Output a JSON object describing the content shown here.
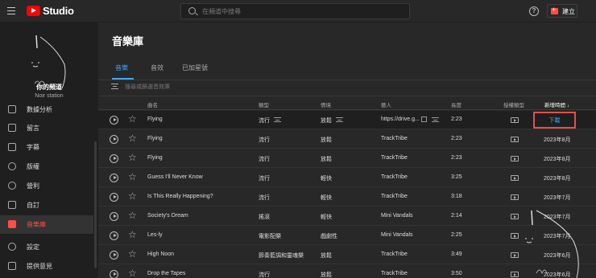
{
  "header": {
    "logo_text": "Studio",
    "search_placeholder": "在頻道中搜尋",
    "help_icon": "?",
    "create_label": "建立"
  },
  "sidebar": {
    "channel_name": "你的頻道",
    "channel_subtitle": "Noir station",
    "items": [
      {
        "label": "數據分析",
        "icon": "analytics-icon"
      },
      {
        "label": "留言",
        "icon": "comments-icon"
      },
      {
        "label": "字幕",
        "icon": "subtitles-icon"
      },
      {
        "label": "版權",
        "icon": "copyright-icon"
      },
      {
        "label": "營利",
        "icon": "monetization-icon"
      },
      {
        "label": "自訂",
        "icon": "customization-icon"
      },
      {
        "label": "音樂庫",
        "icon": "audio-library-icon"
      },
      {
        "label": "設定",
        "icon": "settings-icon"
      },
      {
        "label": "提供意見",
        "icon": "feedback-icon"
      }
    ],
    "active_index": 6
  },
  "main": {
    "title": "音樂庫",
    "tabs": [
      {
        "label": "音樂"
      },
      {
        "label": "音效"
      },
      {
        "label": "已加星號"
      }
    ],
    "filter_placeholder": "搜尋或篩選音效庫",
    "columns": {
      "title": "曲名",
      "genre": "類型",
      "mood": "情境",
      "artist": "藝人",
      "duration": "長度",
      "license": "授權類型",
      "added": "新增時間 ↓"
    },
    "rows": [
      {
        "title": "Flying",
        "genre": "流行",
        "mood": "放鬆",
        "artist": "https://drive.g...",
        "duration": "2:23",
        "added": "下載"
      },
      {
        "title": "Flying",
        "genre": "流行",
        "mood": "放鬆",
        "artist": "TrackTribe",
        "duration": "2:23",
        "added": "2023年8月"
      },
      {
        "title": "Flying",
        "genre": "流行",
        "mood": "放鬆",
        "artist": "TrackTribe",
        "duration": "2:23",
        "added": "2023年8月"
      },
      {
        "title": "Guess I'll Never Know",
        "genre": "流行",
        "mood": "輕快",
        "artist": "TrackTribe",
        "duration": "3:25",
        "added": "2023年8月"
      },
      {
        "title": "Is This Really Happening?",
        "genre": "流行",
        "mood": "輕快",
        "artist": "TrackTribe",
        "duration": "3:18",
        "added": "2023年7月"
      },
      {
        "title": "Society's Dream",
        "genre": "搖滾",
        "mood": "輕快",
        "artist": "Mini Vandals",
        "duration": "2:14",
        "added": "2023年7月"
      },
      {
        "title": "Les-ly",
        "genre": "電影配樂",
        "mood": "戲劇性",
        "artist": "Mini Vandals",
        "duration": "2:25",
        "added": "2023年7月"
      },
      {
        "title": "High Noon",
        "genre": "節奏藍調和靈魂樂",
        "mood": "放鬆",
        "artist": "TrackTribe",
        "duration": "3:49",
        "added": "2023年6月"
      },
      {
        "title": "Drop the Tapes",
        "genre": "流行",
        "mood": "放鬆",
        "artist": "TrackTribe",
        "duration": "3:50",
        "added": "2023年6月"
      }
    ]
  },
  "colors": {
    "accent_blue": "#3ea6ff",
    "brand_red": "#ff0000",
    "highlight_box": "#e0514d"
  }
}
